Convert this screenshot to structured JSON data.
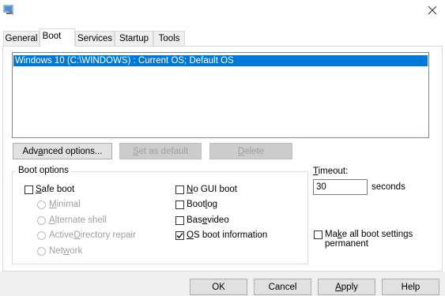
{
  "window": {
    "icon": "system-configuration-icon",
    "close_icon": "close-icon"
  },
  "tabs": [
    {
      "label": "General"
    },
    {
      "label": "Boot",
      "active": true
    },
    {
      "label": "Services"
    },
    {
      "label": "Startup"
    },
    {
      "label": "Tools"
    }
  ],
  "boot": {
    "os_entries": [
      "Windows 10 (C:\\WINDOWS) : Current OS; Default OS"
    ],
    "buttons": {
      "advanced_pre": "Adv",
      "advanced_u": "a",
      "advanced_post": "nced options...",
      "set_default_pre": "",
      "set_default_u": "S",
      "set_default_post": "et as default",
      "delete_pre": "",
      "delete_u": "D",
      "delete_post": "elete"
    },
    "boot_options": {
      "legend": "Boot options",
      "safe_boot_pre": "",
      "safe_boot_u": "S",
      "safe_boot_post": "afe boot",
      "safe_boot_checked": false,
      "radios": [
        {
          "pre": "",
          "u": "M",
          "post": "inimal"
        },
        {
          "pre": "",
          "u": "A",
          "post": "lternate shell"
        },
        {
          "pre": "Active ",
          "u": "D",
          "post": "irectory repair"
        },
        {
          "pre": "Net",
          "u": "w",
          "post": "ork"
        }
      ],
      "no_gui_pre": "",
      "no_gui_u": "N",
      "no_gui_post": "o GUI boot",
      "no_gui_checked": false,
      "boot_log_pre": "Boot ",
      "boot_log_u": "l",
      "boot_log_post": "og",
      "boot_log_checked": false,
      "base_video_pre": "Bas",
      "base_video_u": "e",
      "base_video_post": " video",
      "base_video_checked": false,
      "os_info_pre": "",
      "os_info_u": "O",
      "os_info_post": "S boot information",
      "os_info_checked": true
    },
    "timeout": {
      "label_pre": "",
      "label_u": "T",
      "label_post": "imeout:",
      "value": "30",
      "unit": "seconds"
    },
    "make_permanent": {
      "line1_pre": "Ma",
      "line1_u": "k",
      "line1_post": "e all boot settings",
      "line2": "permanent",
      "checked": false
    }
  },
  "dialog_buttons": {
    "ok": "OK",
    "cancel": "Cancel",
    "apply_u": "A",
    "apply_post": "pply",
    "help": "Help"
  }
}
